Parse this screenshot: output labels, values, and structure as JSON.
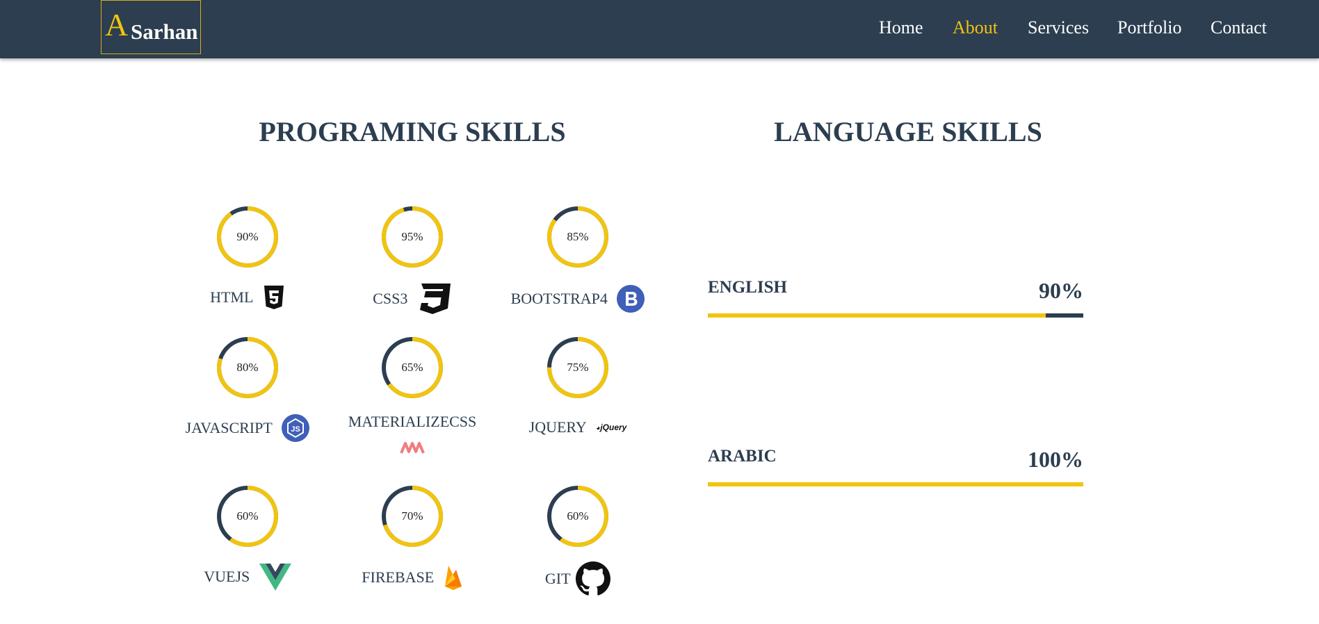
{
  "brand": {
    "initial": "A",
    "name": "Sarhan"
  },
  "nav": {
    "home": "Home",
    "about": "About",
    "services": "Services",
    "portfolio": "Portfolio",
    "contact": "Contact",
    "active": "About"
  },
  "programming": {
    "title": "PROGRAMING SKILLS",
    "skills": [
      {
        "name": "HTML",
        "percent_label": "90%",
        "value": 90,
        "icon": "html5-icon"
      },
      {
        "name": "CSS3",
        "percent_label": "95%",
        "value": 95,
        "icon": "css3-icon"
      },
      {
        "name": "BOOTSTRAP4",
        "percent_label": "85%",
        "value": 85,
        "icon": "bootstrap-icon"
      },
      {
        "name": "JAVASCRIPT",
        "percent_label": "80%",
        "value": 80,
        "icon": "nodejs-icon"
      },
      {
        "name": "MATERIALIZECSS",
        "percent_label": "65%",
        "value": 65,
        "icon": "materialize-icon"
      },
      {
        "name": "JQUERY",
        "percent_label": "75%",
        "value": 75,
        "icon": "jquery-icon"
      },
      {
        "name": "VUEJS",
        "percent_label": "60%",
        "value": 60,
        "icon": "vuejs-icon"
      },
      {
        "name": "FIREBASE",
        "percent_label": "70%",
        "value": 70,
        "icon": "firebase-icon"
      },
      {
        "name": "GIT",
        "percent_label": "60%",
        "value": 60,
        "icon": "github-icon"
      }
    ],
    "jquery_logo_text": "jQuery"
  },
  "languages": {
    "title": "LANGUAGE SKILLS",
    "items": [
      {
        "name": "ENGLISH",
        "percent_label": "90%",
        "value": 90
      },
      {
        "name": "ARABIC",
        "percent_label": "100%",
        "value": 100
      }
    ]
  },
  "colors": {
    "navy": "#2c3e50",
    "accent": "#f1c40f"
  }
}
